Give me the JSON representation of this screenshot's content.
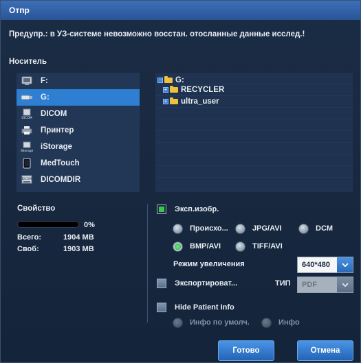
{
  "window": {
    "title": "Отпр"
  },
  "warning": "Предупр.: в УЗ-системе невозможно восстан. отосланные данные исслед.!",
  "media": {
    "label": "Носитель",
    "items": [
      {
        "label": "F:",
        "icon": "drive-icon"
      },
      {
        "label": "G:",
        "icon": "usb-drive-icon",
        "selected": true
      },
      {
        "label": "DICOM",
        "icon": "dicom-icon"
      },
      {
        "label": "Принтер",
        "icon": "printer-icon"
      },
      {
        "label": "iStorage",
        "icon": "istorage-icon"
      },
      {
        "label": "MedTouch",
        "icon": "tablet-icon"
      },
      {
        "label": "DICOMDIR",
        "icon": "dicomdir-icon"
      }
    ]
  },
  "tree": {
    "root": "G:",
    "children": [
      "RECYCLER",
      "ultra_user"
    ]
  },
  "property": {
    "label": "Свойство",
    "percent": "0%",
    "total_label": "Всего:",
    "total_value": "1904 MB",
    "free_label": "Своб:",
    "free_value": "1903 MB"
  },
  "export_image": {
    "label": "Эксп.изобр.",
    "checked": true,
    "formats": [
      {
        "label": "Происхо...",
        "selected": false
      },
      {
        "label": "JPG/AVI",
        "selected": false
      },
      {
        "label": "DCM",
        "selected": false
      },
      {
        "label": "BMP/AVI",
        "selected": true
      },
      {
        "label": "TIFF/AVI",
        "selected": false
      }
    ],
    "zoom_label": "Режим увеличения",
    "zoom_value": "640*480"
  },
  "export_report": {
    "label": "Экспортироват...",
    "checked": false,
    "type_label": "ТИП",
    "type_value": "PDF"
  },
  "hide_patient": {
    "label": "Hide Patient Info",
    "checked": false,
    "options": [
      "Инфо по умолч.",
      "Инфо"
    ]
  },
  "buttons": {
    "ok": "Готово",
    "cancel": "Отмена"
  },
  "colors": {
    "accent": "#2e7fd2",
    "titlebar": "#2a5597",
    "check_on": "#38c84a"
  }
}
